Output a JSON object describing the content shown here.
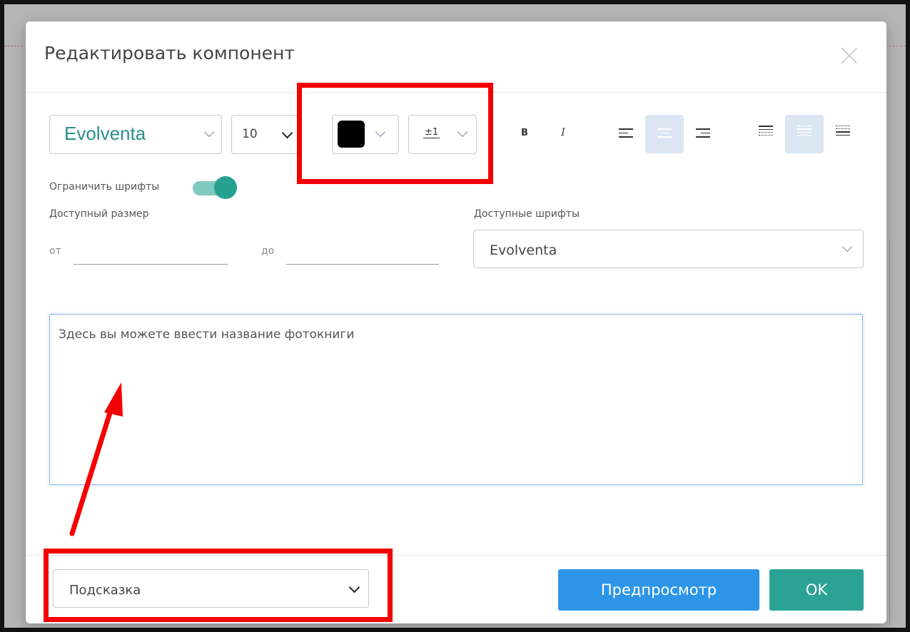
{
  "dialog": {
    "title": "Редактировать компонент",
    "close_icon": "close-icon"
  },
  "toolbar": {
    "font_family": "Evolventa",
    "font_size": "10",
    "color": "#000000",
    "line_height_icon": "line-height-icon",
    "line_height_glyph": "±1",
    "bold_label": "B",
    "italic_label": "I",
    "align_active": "center",
    "valign_active": "middle"
  },
  "restrict_fonts": {
    "label": "Ограничить шрифты",
    "enabled": true
  },
  "size_range": {
    "label": "Доступный размер",
    "from_label": "от",
    "to_label": "до",
    "from_value": "",
    "to_value": ""
  },
  "available_fonts": {
    "label": "Доступные шрифты",
    "value": "Evolventa"
  },
  "text_area": {
    "placeholder": "Здесь вы можете ввести название фотокниги"
  },
  "footer": {
    "hint_select": "Подсказка",
    "preview_button": "Предпросмотр",
    "ok_button": "OK"
  },
  "annotations": {
    "highlight_color": "#f40000",
    "arrow_color": "#f40000"
  },
  "colors": {
    "accent_teal": "#2ba394",
    "accent_blue": "#2c95e8",
    "font_teal": "#2a8e8a"
  }
}
